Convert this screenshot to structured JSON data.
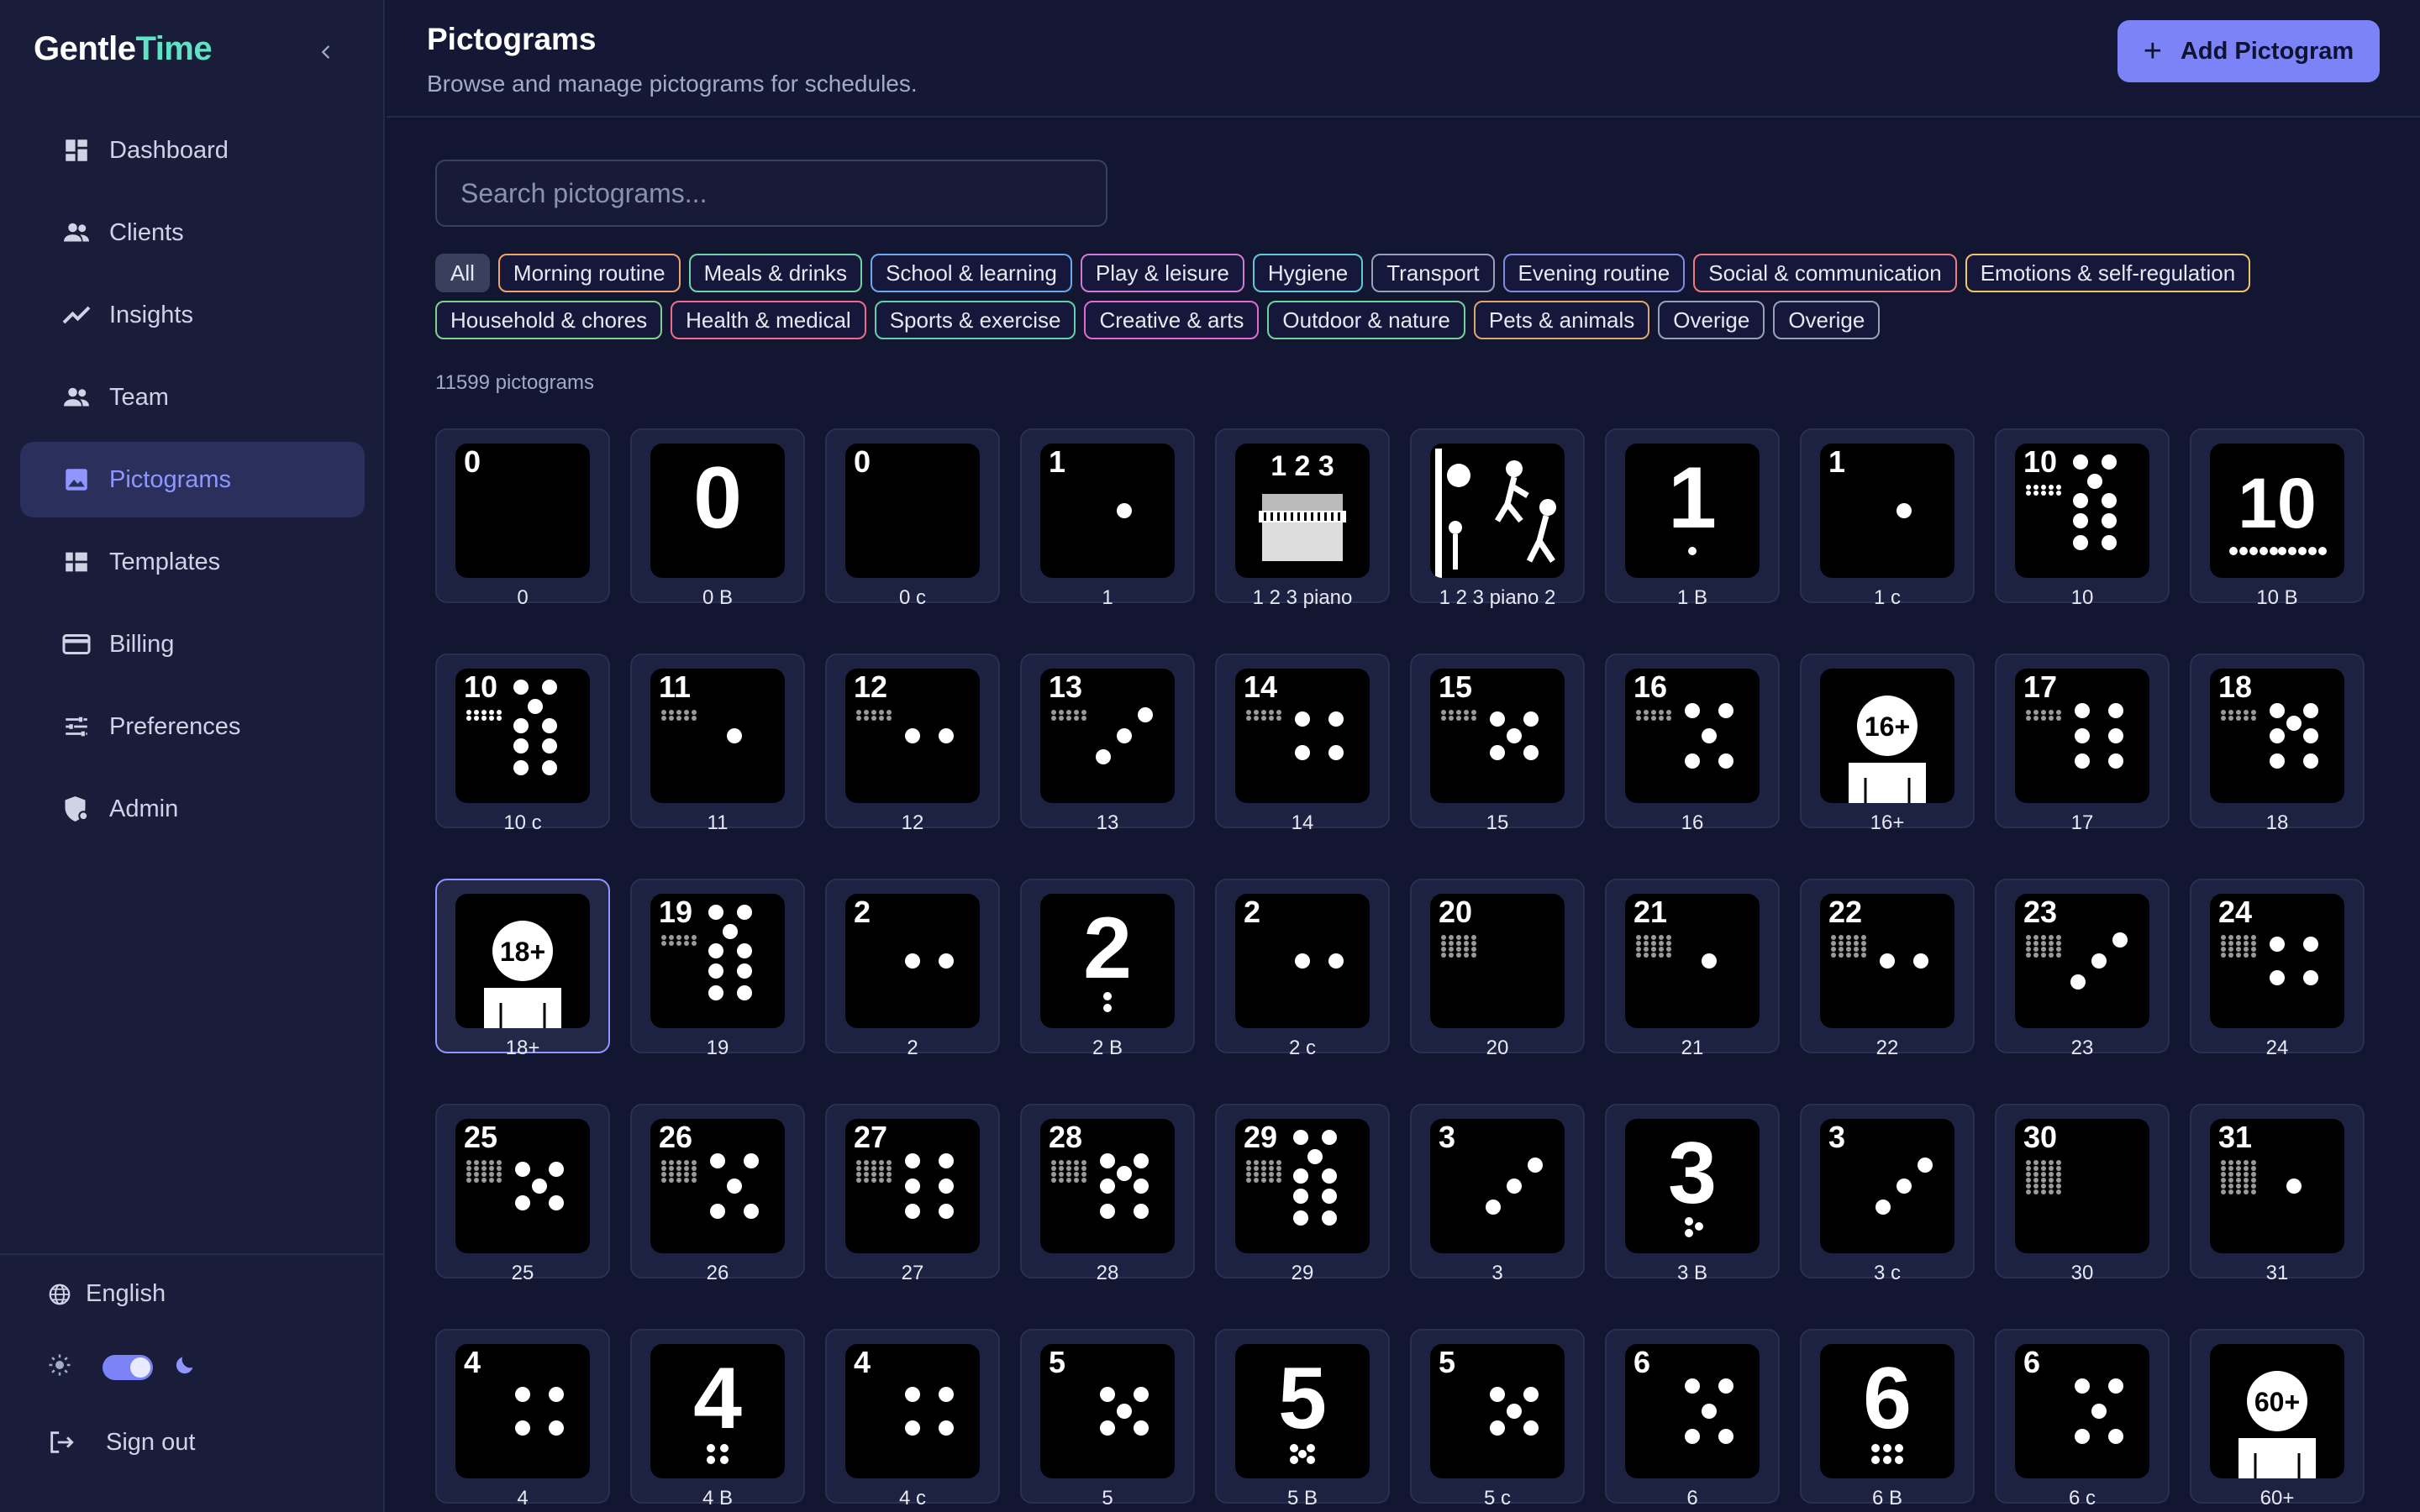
{
  "brand": {
    "part1": "Gentle",
    "part2": "Time"
  },
  "sidebar": {
    "items": [
      {
        "label": "Dashboard",
        "icon": "dashboard-icon"
      },
      {
        "label": "Clients",
        "icon": "people-icon"
      },
      {
        "label": "Insights",
        "icon": "trend-icon"
      },
      {
        "label": "Team",
        "icon": "people-icon"
      },
      {
        "label": "Pictograms",
        "icon": "image-icon",
        "active": true
      },
      {
        "label": "Templates",
        "icon": "table-icon"
      },
      {
        "label": "Billing",
        "icon": "card-icon"
      },
      {
        "label": "Preferences",
        "icon": "sliders-icon"
      },
      {
        "label": "Admin",
        "icon": "shield-icon"
      }
    ],
    "language": "English",
    "sign_out": "Sign out"
  },
  "header": {
    "title": "Pictograms",
    "subtitle": "Browse and manage pictograms for schedules.",
    "add_label": "Add Pictogram"
  },
  "search": {
    "placeholder": "Search pictograms..."
  },
  "filters": {
    "row1": [
      {
        "label": "All",
        "color": "#3a3f5e",
        "active": true
      },
      {
        "label": "Morning routine",
        "color": "#f0a46a"
      },
      {
        "label": "Meals & drinks",
        "color": "#6fd3a8"
      },
      {
        "label": "School & learning",
        "color": "#6aa8f0"
      },
      {
        "label": "Play & leisure",
        "color": "#d07ad8"
      },
      {
        "label": "Hygiene",
        "color": "#5fc9d8"
      },
      {
        "label": "Transport",
        "color": "#9a9fb8"
      },
      {
        "label": "Evening routine",
        "color": "#7d8ce0"
      },
      {
        "label": "Social & communication",
        "color": "#f07a7a"
      },
      {
        "label": "Emotions & self-regulation",
        "color": "#f0c46a"
      }
    ],
    "row2": [
      {
        "label": "Household & chores",
        "color": "#7fd08a"
      },
      {
        "label": "Health & medical",
        "color": "#f06a8a"
      },
      {
        "label": "Sports & exercise",
        "color": "#5fd0b0"
      },
      {
        "label": "Creative & arts",
        "color": "#e06ad0"
      },
      {
        "label": "Outdoor & nature",
        "color": "#6fd39a"
      },
      {
        "label": "Pets & animals",
        "color": "#e0a66a"
      },
      {
        "label": "Overige",
        "color": "#9a9fb8"
      },
      {
        "label": "Overige",
        "color": "#9a9fb8"
      }
    ]
  },
  "count_text": "11599 pictograms",
  "pictograms": [
    {
      "label": "0",
      "icon": "number-0"
    },
    {
      "label": "0 B",
      "icon": "number-0-big"
    },
    {
      "label": "0 c",
      "icon": "number-0"
    },
    {
      "label": "1",
      "icon": "number-1-dots"
    },
    {
      "label": "1 2 3 piano",
      "icon": "piano-icon"
    },
    {
      "label": "1 2 3 piano 2",
      "icon": "piano-people-icon"
    },
    {
      "label": "1 B",
      "icon": "number-1-big"
    },
    {
      "label": "1 c",
      "icon": "number-1-dots"
    },
    {
      "label": "10",
      "icon": "number-10-dots"
    },
    {
      "label": "10 B",
      "icon": "number-10-big"
    },
    {
      "label": "10 c",
      "icon": "number-10-dots"
    },
    {
      "label": "11",
      "icon": "number-11-dots"
    },
    {
      "label": "12",
      "icon": "number-12-dots"
    },
    {
      "label": "13",
      "icon": "number-13-dots"
    },
    {
      "label": "14",
      "icon": "number-14-dots"
    },
    {
      "label": "15",
      "icon": "number-15-dots"
    },
    {
      "label": "16",
      "icon": "number-16-dots"
    },
    {
      "label": "16+",
      "icon": "age-16-plus-icon"
    },
    {
      "label": "17",
      "icon": "number-17-dots"
    },
    {
      "label": "18",
      "icon": "number-18-dots"
    },
    {
      "label": "18+",
      "icon": "age-18-plus-icon",
      "selected": true
    },
    {
      "label": "19",
      "icon": "number-19-dots"
    },
    {
      "label": "2",
      "icon": "number-2-dots"
    },
    {
      "label": "2 B",
      "icon": "number-2-big"
    },
    {
      "label": "2 c",
      "icon": "number-2-dots"
    },
    {
      "label": "20",
      "icon": "number-20-dots"
    },
    {
      "label": "21",
      "icon": "number-21-dots"
    },
    {
      "label": "22",
      "icon": "number-22-dots"
    },
    {
      "label": "23",
      "icon": "number-23-dots"
    },
    {
      "label": "24",
      "icon": "number-24-dots"
    },
    {
      "label": "25",
      "icon": "number-25-dots"
    },
    {
      "label": "26",
      "icon": "number-26-dots"
    },
    {
      "label": "27",
      "icon": "number-27-dots"
    },
    {
      "label": "28",
      "icon": "number-28-dots"
    },
    {
      "label": "29",
      "icon": "number-29-dots"
    },
    {
      "label": "3",
      "icon": "number-3-dots"
    },
    {
      "label": "3 B",
      "icon": "number-3-big"
    },
    {
      "label": "3 c",
      "icon": "number-3-dots"
    },
    {
      "label": "30",
      "icon": "number-30-dots"
    },
    {
      "label": "31",
      "icon": "number-31-dots"
    },
    {
      "label": "4",
      "icon": "number-4-dots"
    },
    {
      "label": "4 B",
      "icon": "number-4-big"
    },
    {
      "label": "4 c",
      "icon": "number-4-dots"
    },
    {
      "label": "5",
      "icon": "number-5-dots"
    },
    {
      "label": "5 B",
      "icon": "number-5-big"
    },
    {
      "label": "5 c",
      "icon": "number-5-dots"
    },
    {
      "label": "6",
      "icon": "number-6-dots"
    },
    {
      "label": "6 B",
      "icon": "number-6-big"
    },
    {
      "label": "6 c",
      "icon": "number-6-dots"
    },
    {
      "label": "60+",
      "icon": "age-60-plus-icon"
    }
  ]
}
